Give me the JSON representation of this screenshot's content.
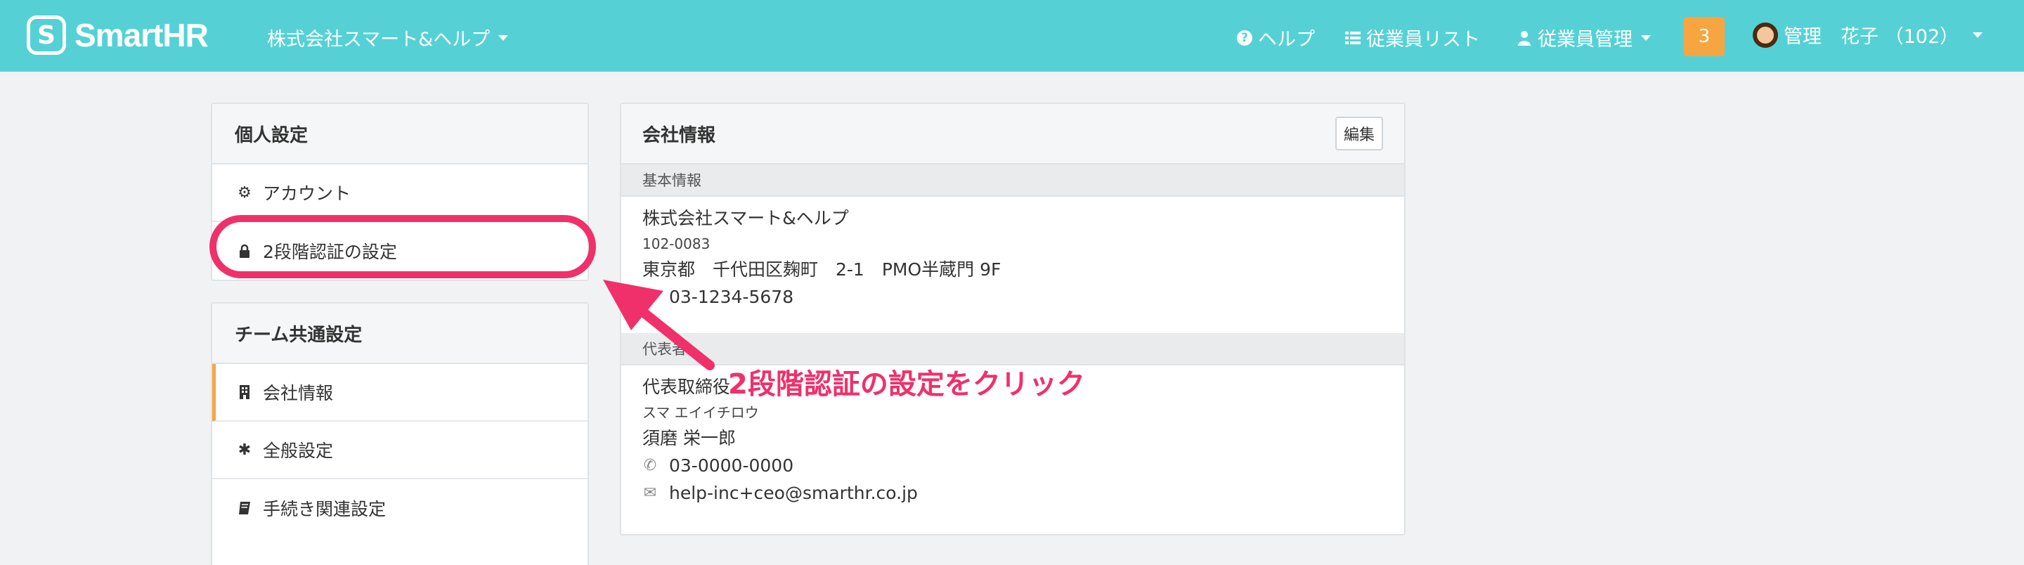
{
  "header": {
    "brand": "SmartHR",
    "company": "株式会社スマート&ヘルプ",
    "help": "ヘルプ",
    "employee_list": "従業員リスト",
    "employee_admin": "従業員管理",
    "notification_count": "3",
    "user_name": "管理　花子 （102）"
  },
  "personal_settings": {
    "title": "個人設定",
    "items": [
      {
        "label": "アカウント",
        "icon": "gear-icon"
      },
      {
        "label": "2段階認証の設定",
        "icon": "lock-icon"
      }
    ]
  },
  "team_settings": {
    "title": "チーム共通設定",
    "items": [
      {
        "label": "会社情報",
        "icon": "building-icon"
      },
      {
        "label": "全般設定",
        "icon": "asterisk-icon"
      },
      {
        "label": "手続き関連設定",
        "icon": "book-icon"
      }
    ]
  },
  "company_info": {
    "title": "会社情報",
    "edit_label": "編集",
    "basic_section": "基本情報",
    "company_name": "株式会社スマート&ヘルプ",
    "postal_code": "102-0083",
    "address": "東京都　千代田区麹町　2-1　PMO半蔵門 9F",
    "phone": "03-1234-5678",
    "rep_section": "代表者",
    "rep_title": "代表取締役",
    "rep_kana": "スマ エイイチロウ",
    "rep_name": "須磨 栄一郎",
    "rep_phone": "03-0000-0000",
    "rep_email": "help-inc+ceo@smarthr.co.jp"
  },
  "annotation": {
    "text": "2段階認証の設定をクリック",
    "color": "#f0306a"
  },
  "colors": {
    "header_bg": "#55d1d5",
    "badge": "#f7a540",
    "active_accent": "#f7a540"
  }
}
